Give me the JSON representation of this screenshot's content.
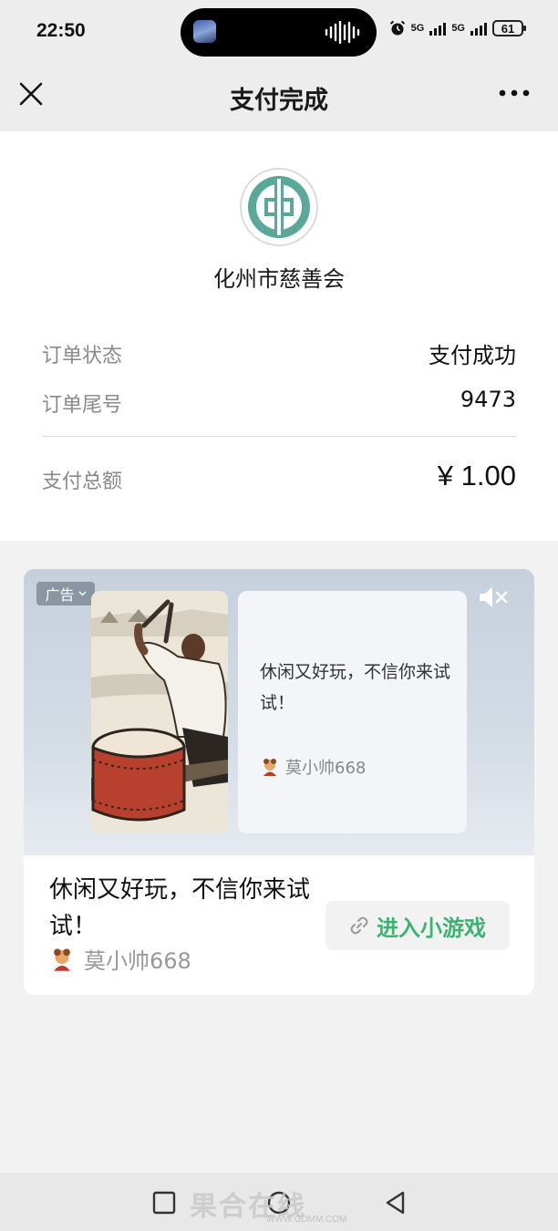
{
  "status_bar": {
    "time": "22:50",
    "battery": "61",
    "network_1": "5G",
    "network_2": "5G"
  },
  "nav": {
    "title": "支付完成"
  },
  "merchant": {
    "name": "化州市慈善会"
  },
  "order": {
    "status_label": "订单状态",
    "status_value": "支付成功",
    "tail_label": "订单尾号",
    "tail_value": "9473",
    "total_label": "支付总额",
    "total_value": "¥ 1.00"
  },
  "ad": {
    "tag": "广告",
    "preview_text": "休闲又好玩，不信你来试试！",
    "preview_author": "莫小帅668",
    "title": "休闲又好玩，不信你来试试！",
    "author": "莫小帅668",
    "button_label": "进入小游戏"
  },
  "watermark": {
    "text": "果合在线",
    "sub": "WWW.GDMM.COM"
  },
  "colors": {
    "accent_green": "#3cb371",
    "logo_teal": "#5aa89a",
    "page_bg": "#f2f2f2"
  }
}
